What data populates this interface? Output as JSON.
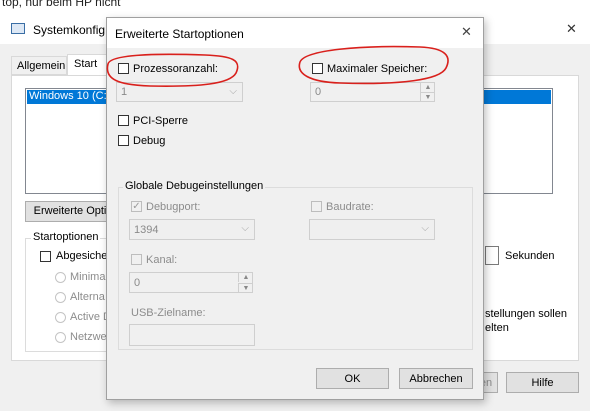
{
  "top_cut_text": "top, nur beim HP nicht",
  "bg_window": {
    "title": "Systemkonfig",
    "tabs": [
      "Allgemein",
      "Start"
    ],
    "list_item": "Windows 10 (C:",
    "advanced_button": "Erweiterte Opti",
    "startoptions_label": "Startoptionen",
    "safe_boot_label": "Abgesicher",
    "radio_labels": [
      "Minimal",
      "Alterna",
      "Active D",
      "Netzwe"
    ],
    "seconds_label": "Sekunden",
    "note_line1": "stellungen sollen",
    "note_line2": "elten",
    "partial_button": "en",
    "help_button": "Hilfe",
    "close_symbol": "✕"
  },
  "dialog": {
    "title": "Erweiterte Startoptionen",
    "close_symbol": "✕",
    "processor_count_label": "Prozessoranzahl:",
    "processor_count_value": "1",
    "max_memory_label": "Maximaler Speicher:",
    "max_memory_value": "0",
    "pci_lock_label": "PCI-Sperre",
    "debug_label": "Debug",
    "global_debug_group": "Globale Debugeinstellungen",
    "debugport_label": "Debugport:",
    "debugport_value": "1394",
    "baudrate_label": "Baudrate:",
    "baudrate_value": "",
    "channel_label": "Kanal:",
    "channel_value": "0",
    "usb_target_label": "USB-Zielname:",
    "usb_target_value": "",
    "ok_button": "OK",
    "cancel_button": "Abbrechen"
  },
  "annotation_color": "#d9201c"
}
